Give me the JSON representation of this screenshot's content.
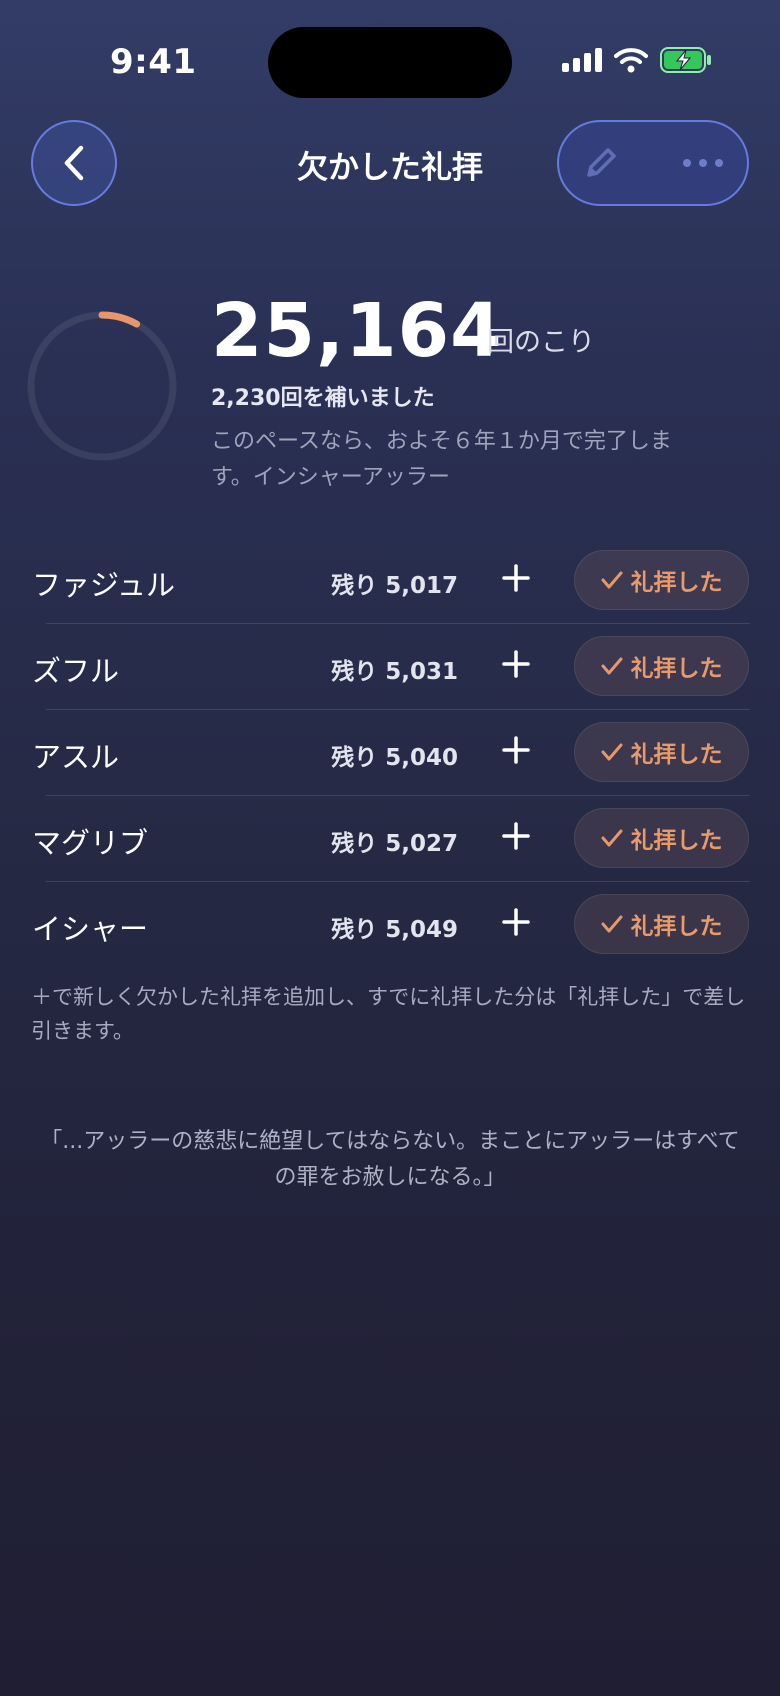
{
  "status_bar": {
    "time": "9:41",
    "icons": [
      "cellular-signal-icon",
      "wifi-icon",
      "battery-charging-icon"
    ],
    "battery_color": "#34c759"
  },
  "nav": {
    "title": "欠かした礼拝",
    "back_icon": "chevron-left-icon",
    "edit_icon": "pencil-icon",
    "more_icon": "ellipsis-icon"
  },
  "summary": {
    "remaining_count": "25,164",
    "remaining_unit": "回のこり",
    "made_up": "2,230回を補いました",
    "pace_text": "このペースなら、およそ６年１か月で完了します。インシャーアッラー",
    "progress_fraction": 0.081,
    "progress_color": "#e8976a"
  },
  "prayers": [
    {
      "name": "ファジュル",
      "remaining": "残り 5,017",
      "button": "礼拝した"
    },
    {
      "name": "ズフル",
      "remaining": "残り 5,031",
      "button": "礼拝した"
    },
    {
      "name": "アスル",
      "remaining": "残り 5,040",
      "button": "礼拝した"
    },
    {
      "name": "マグリブ",
      "remaining": "残り 5,027",
      "button": "礼拝した"
    },
    {
      "name": "イシャー",
      "remaining": "残り 5,049",
      "button": "礼拝した"
    }
  ],
  "hint": "＋で新しく欠かした礼拝を追加し、すでに礼拝した分は「礼拝した」で差し引きます。",
  "quote": "「...アッラーの慈悲に絶望してはならない。まことにアッラーはすべての罪をお赦しになる。」",
  "colors": {
    "accent": "#e8976a",
    "nav_border": "#6e87f0"
  }
}
